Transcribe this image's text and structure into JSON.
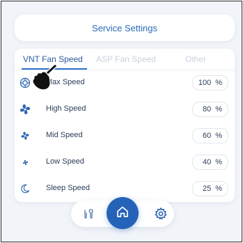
{
  "header": {
    "title": "Service Settings"
  },
  "tabs": [
    {
      "label": "VNT Fan Speed",
      "active": true
    },
    {
      "label": "ASP Fan Speed",
      "active": false
    },
    {
      "label": "Other",
      "active": false
    }
  ],
  "speeds": [
    {
      "label": "Max Speed",
      "value": "100",
      "unit": "%",
      "icon": "max-fan-icon"
    },
    {
      "label": "High Speed",
      "value": "80",
      "unit": "%",
      "icon": "fan-high-icon"
    },
    {
      "label": "Mid Speed",
      "value": "60",
      "unit": "%",
      "icon": "fan-mid-icon"
    },
    {
      "label": "Low Speed",
      "value": "40",
      "unit": "%",
      "icon": "fan-low-icon"
    },
    {
      "label": "Sleep Speed",
      "value": "25",
      "unit": "%",
      "icon": "moon-icon"
    }
  ],
  "nav": {
    "left_icon": "tools-icon",
    "center_icon": "home-icon",
    "right_icon": "gear-icon"
  },
  "colors": {
    "accent": "#2563b8",
    "title": "#2b6bb8",
    "background": "#f1f4f9"
  }
}
